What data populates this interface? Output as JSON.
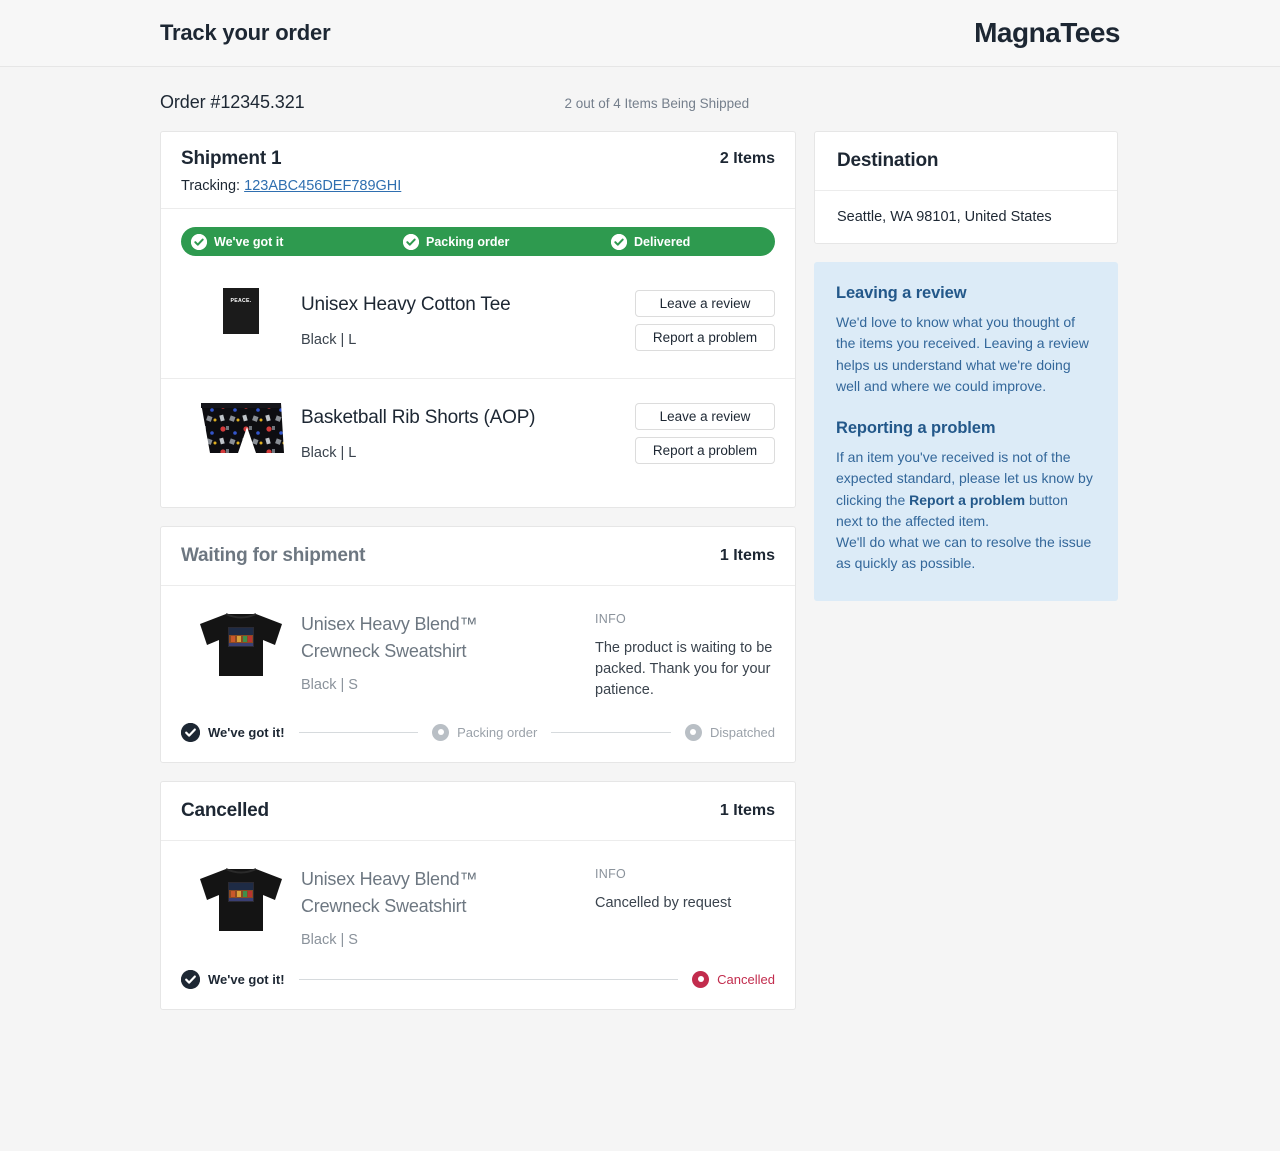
{
  "header": {
    "title": "Track your order",
    "brand": "MagnaTees"
  },
  "order": {
    "id_label": "Order #12345.321",
    "status_label": "2 out of 4 Items Being Shipped"
  },
  "shipment": {
    "title": "Shipment 1",
    "count_label": "2 Items",
    "tracking_prefix": "Tracking:",
    "tracking_number": "123ABC456DEF789GHI",
    "progress": {
      "color": "#2e9a4f",
      "steps": [
        {
          "label": "We've got it",
          "state": "done"
        },
        {
          "label": "Packing order",
          "state": "done"
        },
        {
          "label": "Delivered",
          "state": "done"
        }
      ]
    },
    "items": [
      {
        "name": "Unisex Heavy Cotton Tee",
        "variant": "Black | L",
        "thumb": "tee-black-peace",
        "review_label": "Leave a review",
        "report_label": "Report a problem"
      },
      {
        "name": "Basketball Rib Shorts (AOP)",
        "variant": "Black | L",
        "thumb": "shorts-black-aop",
        "review_label": "Leave a review",
        "report_label": "Report a problem"
      }
    ]
  },
  "waiting": {
    "title": "Waiting for shipment",
    "count_label": "1 Items",
    "item": {
      "name_line1": "Unisex Heavy Blend™",
      "name_line2": "Crewneck Sweatshirt",
      "variant": "Black | S",
      "thumb": "sweatshirt-black-graphic",
      "info_label": "INFO",
      "info_text": "The product is waiting to be packed. Thank you for your patience."
    },
    "steps": [
      {
        "label": "We've got it!",
        "state": "done"
      },
      {
        "label": "Packing order",
        "state": "todo"
      },
      {
        "label": "Dispatched",
        "state": "todo"
      }
    ]
  },
  "cancelled": {
    "title": "Cancelled",
    "count_label": "1 Items",
    "item": {
      "name_line1": "Unisex Heavy Blend™",
      "name_line2": "Crewneck Sweatshirt",
      "variant": "Black | S",
      "thumb": "sweatshirt-black-graphic",
      "info_label": "INFO",
      "info_text": "Cancelled by request"
    },
    "steps": [
      {
        "label": "We've got it!",
        "state": "done"
      },
      {
        "label": "Cancelled",
        "state": "cancelled"
      }
    ],
    "cancel_color": "#c22c4d"
  },
  "destination": {
    "title": "Destination",
    "address": "Seattle, WA 98101, United States"
  },
  "help": {
    "review_title": "Leaving a review",
    "review_text": "We'd love to know what you thought of the items you received. Leaving a review helps us understand what we're doing well and where we could improve.",
    "problem_title": "Reporting a problem",
    "problem_text_before": "If an item you've received is not of the expected standard, please let us know by clicking the ",
    "problem_text_bold": "Report a problem",
    "problem_text_after": " button next to the affected item.",
    "problem_text_line2": "We'll do what we can to resolve the issue as quickly as possible.",
    "panel_color": "#dcebf7"
  }
}
